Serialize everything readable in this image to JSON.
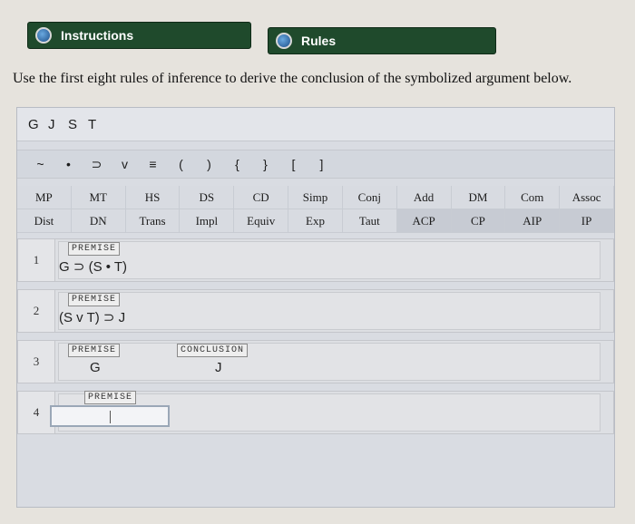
{
  "buttons": {
    "instructions": "Instructions",
    "rules": "Rules"
  },
  "instruction_text": "Use the first eight rules of inference to derive the conclusion of the symbolized argument below.",
  "letters": [
    "G",
    "J",
    "S",
    "T"
  ],
  "symbols": [
    "~",
    "•",
    "⊃",
    "v",
    "≡",
    "(",
    ")",
    "{",
    "}",
    "[",
    "]"
  ],
  "rules_row1": [
    "MP",
    "MT",
    "HS",
    "DS",
    "CD",
    "Simp",
    "Conj",
    "Add",
    "DM",
    "Com",
    "Assoc"
  ],
  "rules_row2": [
    "Dist",
    "DN",
    "Trans",
    "Impl",
    "Equiv",
    "Exp",
    "Taut",
    "ACP",
    "CP",
    "AIP",
    "IP"
  ],
  "lines": [
    {
      "num": "1",
      "badge": "PREMISE",
      "formula": "G ⊃ (S • T)"
    },
    {
      "num": "2",
      "badge": "PREMISE",
      "formula": "(S v T) ⊃ J"
    },
    {
      "num": "3",
      "badge": "PREMISE",
      "formula": "G",
      "conclusion_badge": "CONCLUSION",
      "conclusion": "J"
    },
    {
      "num": "4",
      "badge": "PREMISE",
      "formula": ""
    }
  ]
}
